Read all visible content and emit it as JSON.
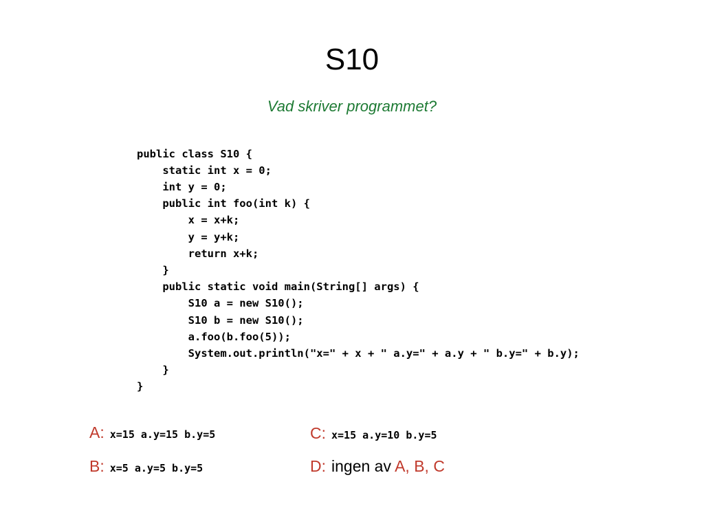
{
  "slide": {
    "title": "S10",
    "subtitle": "Vad skriver programmet?",
    "code": "public class S10 {\n    static int x = 0;\n    int y = 0;\n    public int foo(int k) {\n        x = x+k;\n        y = y+k;\n        return x+k;\n    }\n    public static void main(String[] args) {\n        S10 a = new S10();\n        S10 b = new S10();\n        a.foo(b.foo(5));\n        System.out.println(\"x=\" + x + \" a.y=\" + a.y + \" b.y=\" + b.y);\n    }\n}",
    "answers": [
      {
        "letter": "A:",
        "text": "x=15 a.y=15 b.y=5",
        "style": "mono"
      },
      {
        "letter": "B:",
        "text": "x=5 a.y=5 b.y=5",
        "style": "mono"
      },
      {
        "letter": "C:",
        "text": "x=15 a.y=10 b.y=5",
        "style": "mono"
      },
      {
        "letter": "D:",
        "text": "ingen av A, B, C",
        "style": "prose",
        "prefix": "ingen av ",
        "options": "A, B, C"
      }
    ],
    "colors": {
      "title": "#000000",
      "subtitle": "#1d7a33",
      "answer_letter": "#c0392b",
      "background": "#ffffff"
    }
  }
}
